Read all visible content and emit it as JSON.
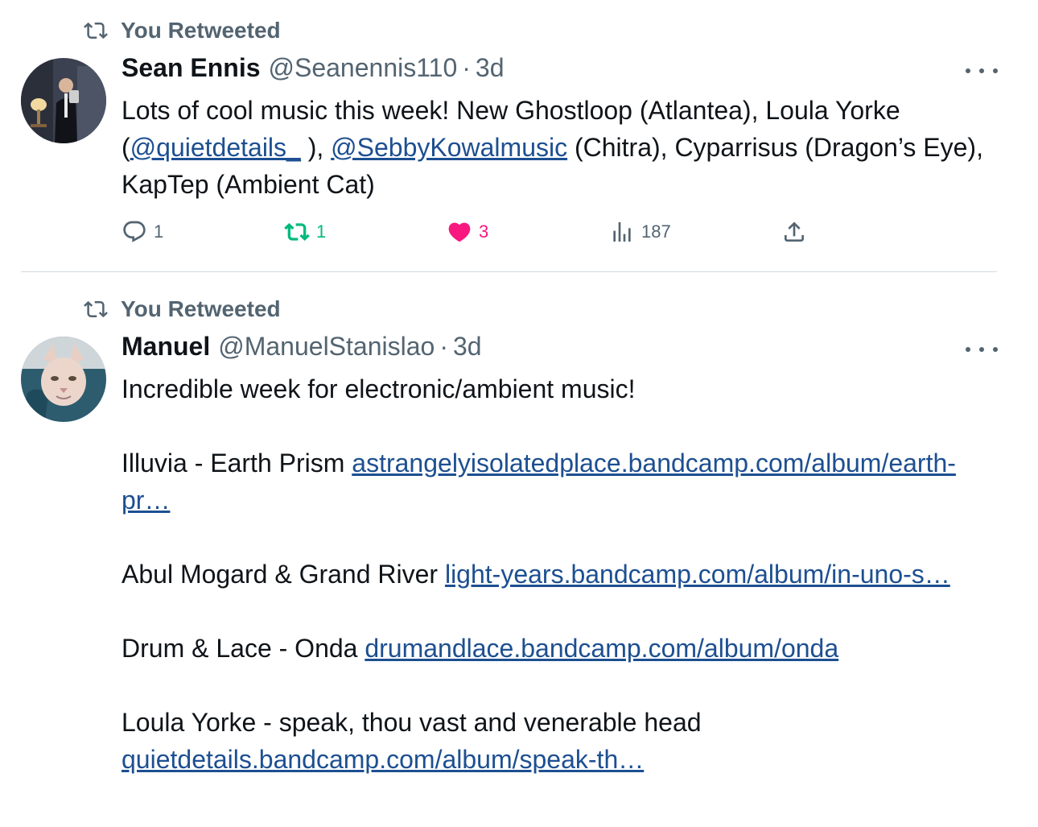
{
  "tweets": [
    {
      "retweet_label": "You Retweeted",
      "name": "Sean Ennis",
      "handle": "@Seanennis110",
      "dot": "·",
      "time": "3d",
      "text_1": "Lots of cool music this week! New Ghostloop (Atlantea), Loula Yorke (",
      "mention_1": "@quietdetails_",
      "text_2": " ), ",
      "mention_2": "@SebbyKowalmusic",
      "text_3": " (Chitra), Cyparrisus (Dragon’s Eye), KapTep (Ambient Cat)",
      "replies": "1",
      "retweets": "1",
      "likes": "3",
      "views": "187",
      "colors": {
        "retweet": "#00ba7c",
        "like": "#f91880"
      }
    },
    {
      "retweet_label": "You Retweeted",
      "name": "Manuel",
      "handle": "@ManuelStanislao",
      "dot": "·",
      "time": "3d",
      "intro": "Incredible week for electronic/ambient music!",
      "items": [
        {
          "label": "Illuvia - Earth Prism ",
          "link": "astrangelyisolatedplace.bandcamp.com/album/earth-pr…"
        },
        {
          "label": "Abul Mogard & Grand River ",
          "link": "light-years.bandcamp.com/album/in-uno-s…"
        },
        {
          "label": "Drum & Lace - Onda ",
          "link": "drumandlace.bandcamp.com/album/onda"
        },
        {
          "label": "Loula Yorke - speak, thou vast and venerable head ",
          "link": "quietdetails.bandcamp.com/album/speak-th…"
        }
      ]
    }
  ],
  "icons": {
    "retweet_banner": "retweet-icon",
    "more": "more-icon",
    "reply": "reply-icon",
    "retweet": "retweet-icon",
    "like": "heart-icon",
    "views": "views-icon",
    "share": "share-icon"
  }
}
